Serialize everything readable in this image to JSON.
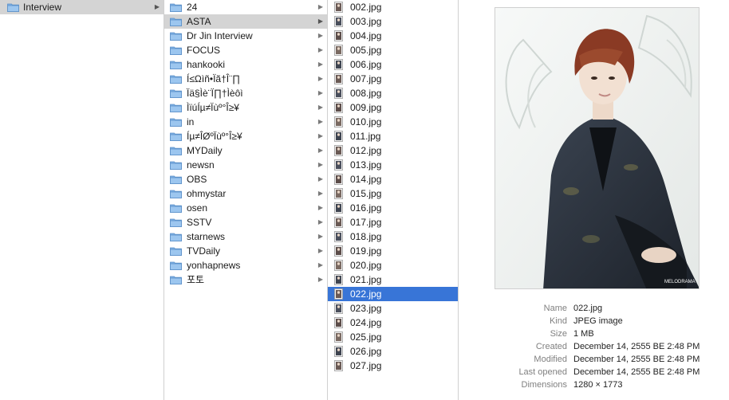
{
  "column1": {
    "items": [
      {
        "label": "Interview",
        "type": "folder",
        "selected": "inactive"
      }
    ]
  },
  "column2": {
    "items": [
      {
        "label": "24"
      },
      {
        "label": "ASTA",
        "selected": "inactive"
      },
      {
        "label": "Dr Jin Interview"
      },
      {
        "label": "FOCUS"
      },
      {
        "label": "hankooki"
      },
      {
        "label": "Í≤Ωìñ•Ïã†Î¨∏"
      },
      {
        "label": "Ïä§Ìè¨Ï∏†Ìèôì"
      },
      {
        "label": "ÌïúÍµ≠Ïùº°Î≥¥"
      },
      {
        "label": "in"
      },
      {
        "label": "Íµ≠ÎØºÏùº°Î≥¥"
      },
      {
        "label": "MYDaily"
      },
      {
        "label": "newsn"
      },
      {
        "label": "OBS"
      },
      {
        "label": "ohmystar"
      },
      {
        "label": "osen"
      },
      {
        "label": "SSTV"
      },
      {
        "label": "starnews"
      },
      {
        "label": "TVDaily"
      },
      {
        "label": "yonhapnews"
      },
      {
        "label": "포토"
      }
    ]
  },
  "column3": {
    "items": [
      {
        "label": "002.jpg"
      },
      {
        "label": "003.jpg"
      },
      {
        "label": "004.jpg"
      },
      {
        "label": "005.jpg"
      },
      {
        "label": "006.jpg"
      },
      {
        "label": "007.jpg"
      },
      {
        "label": "008.jpg"
      },
      {
        "label": "009.jpg"
      },
      {
        "label": "010.jpg"
      },
      {
        "label": "011.jpg"
      },
      {
        "label": "012.jpg"
      },
      {
        "label": "013.jpg"
      },
      {
        "label": "014.jpg"
      },
      {
        "label": "015.jpg"
      },
      {
        "label": "016.jpg"
      },
      {
        "label": "017.jpg"
      },
      {
        "label": "018.jpg"
      },
      {
        "label": "019.jpg"
      },
      {
        "label": "020.jpg"
      },
      {
        "label": "021.jpg"
      },
      {
        "label": "022.jpg",
        "selected": "active"
      },
      {
        "label": "023.jpg"
      },
      {
        "label": "024.jpg"
      },
      {
        "label": "025.jpg"
      },
      {
        "label": "026.jpg"
      },
      {
        "label": "027.jpg"
      }
    ]
  },
  "preview": {
    "info": [
      {
        "key": "Name",
        "value": "022.jpg"
      },
      {
        "key": "Kind",
        "value": "JPEG image"
      },
      {
        "key": "Size",
        "value": "1 MB"
      },
      {
        "key": "Created",
        "value": "December 14, 2555 BE 2:48 PM"
      },
      {
        "key": "Modified",
        "value": "December 14, 2555 BE 2:48 PM"
      },
      {
        "key": "Last opened",
        "value": "December 14, 2555 BE 2:48 PM"
      },
      {
        "key": "Dimensions",
        "value": "1280 × 1773"
      }
    ],
    "photo_caption": "MELODRAMA"
  },
  "colors": {
    "selection_active": "#3875d7",
    "selection_inactive": "#d4d4d4",
    "folder_blue": "#7fb2e6"
  }
}
